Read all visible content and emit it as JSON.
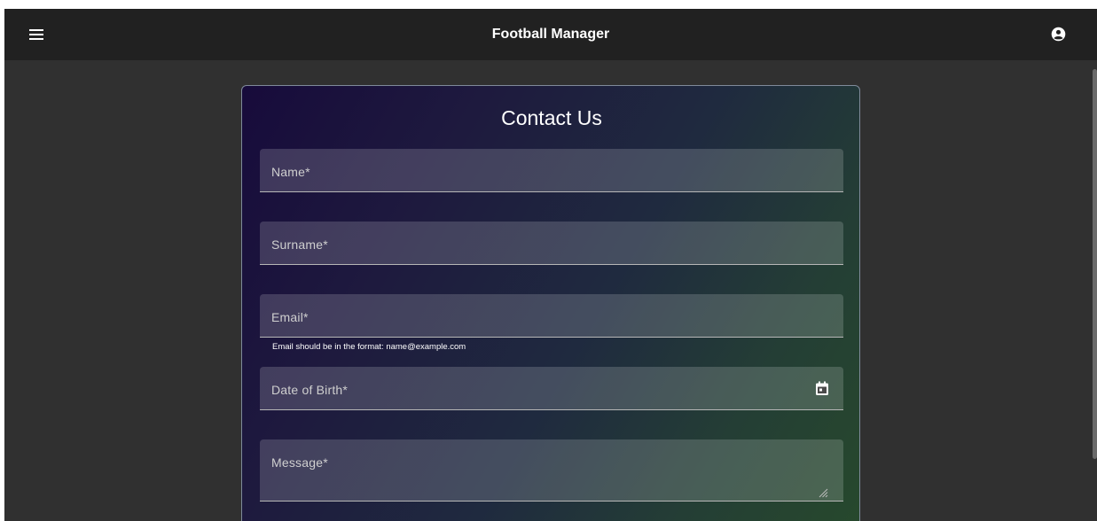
{
  "appbar": {
    "title": "Football Manager",
    "menu_icon": "menu-icon",
    "account_icon": "account-circle-icon"
  },
  "form": {
    "title": "Contact Us",
    "fields": {
      "name": {
        "label": "Name*",
        "value": ""
      },
      "surname": {
        "label": "Surname*",
        "value": ""
      },
      "email": {
        "label": "Email*",
        "value": "",
        "hint": "Email should be in the format: name@example.com"
      },
      "date_of_birth": {
        "label": "Date of Birth*",
        "value": "",
        "icon": "calendar-icon"
      },
      "message": {
        "label": "Message*",
        "value": "",
        "icon": "resize-handle-icon"
      }
    }
  },
  "colors": {
    "appbar_bg": "#212121",
    "page_bg": "#303030",
    "card_gradient_start": "#170b3b",
    "card_gradient_end": "#27492c",
    "field_bg": "#4a4a4a"
  }
}
